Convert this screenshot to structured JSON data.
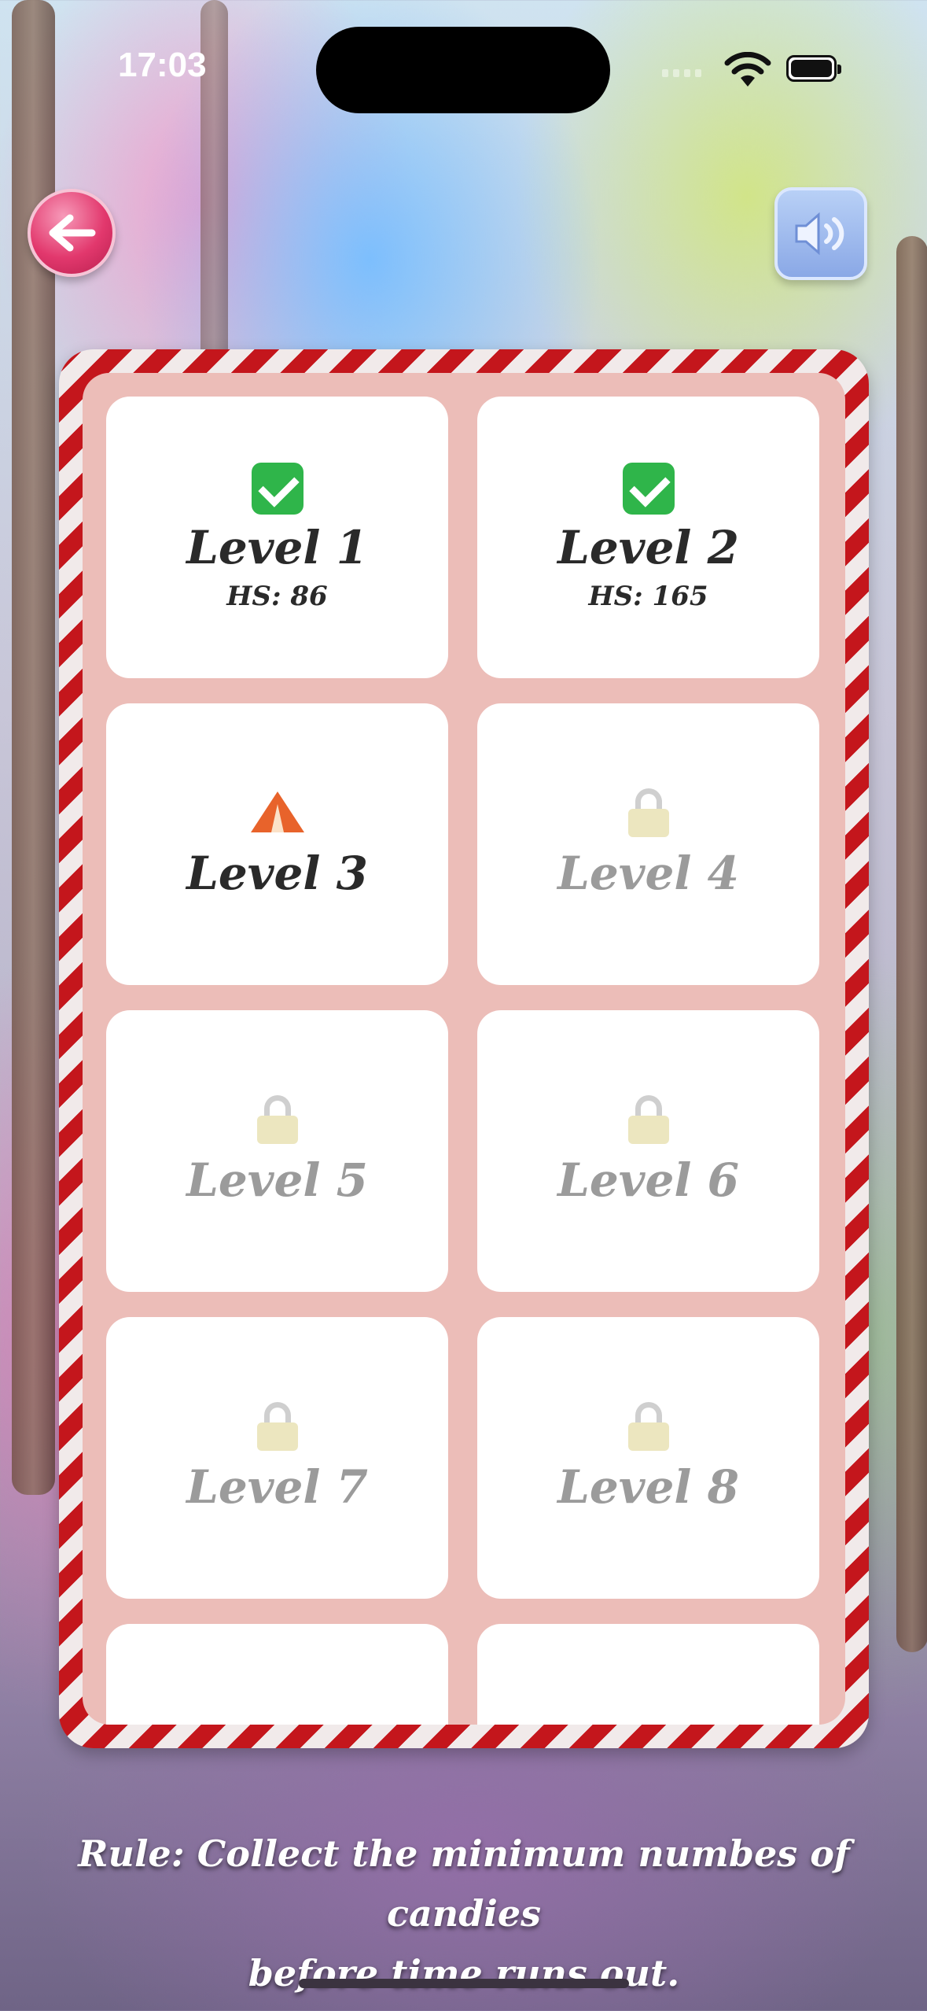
{
  "status_bar": {
    "time": "17:03"
  },
  "header": {
    "back_icon": "arrow-left-icon",
    "sound_icon": "speaker-icon"
  },
  "levels": [
    {
      "label": "Level 1",
      "status": "completed",
      "icon": "check-icon",
      "high_score": "HS: 86"
    },
    {
      "label": "Level 2",
      "status": "completed",
      "icon": "check-icon",
      "high_score": "HS: 165"
    },
    {
      "label": "Level 3",
      "status": "current",
      "icon": "tent-icon"
    },
    {
      "label": "Level 4",
      "status": "locked",
      "icon": "lock-icon"
    },
    {
      "label": "Level 5",
      "status": "locked",
      "icon": "lock-icon"
    },
    {
      "label": "Level 6",
      "status": "locked",
      "icon": "lock-icon"
    },
    {
      "label": "Level 7",
      "status": "locked",
      "icon": "lock-icon"
    },
    {
      "label": "Level 8",
      "status": "locked",
      "icon": "lock-icon"
    }
  ],
  "footer": {
    "rule_line1": "Rule: Collect the minimum numbes of candies",
    "rule_line2": "before time runs out."
  },
  "colors": {
    "stripe_red": "#c4161c",
    "panel_pink": "#ecbdb8",
    "locked_text": "#9b9b9b",
    "completed_green": "#2fb54a"
  }
}
